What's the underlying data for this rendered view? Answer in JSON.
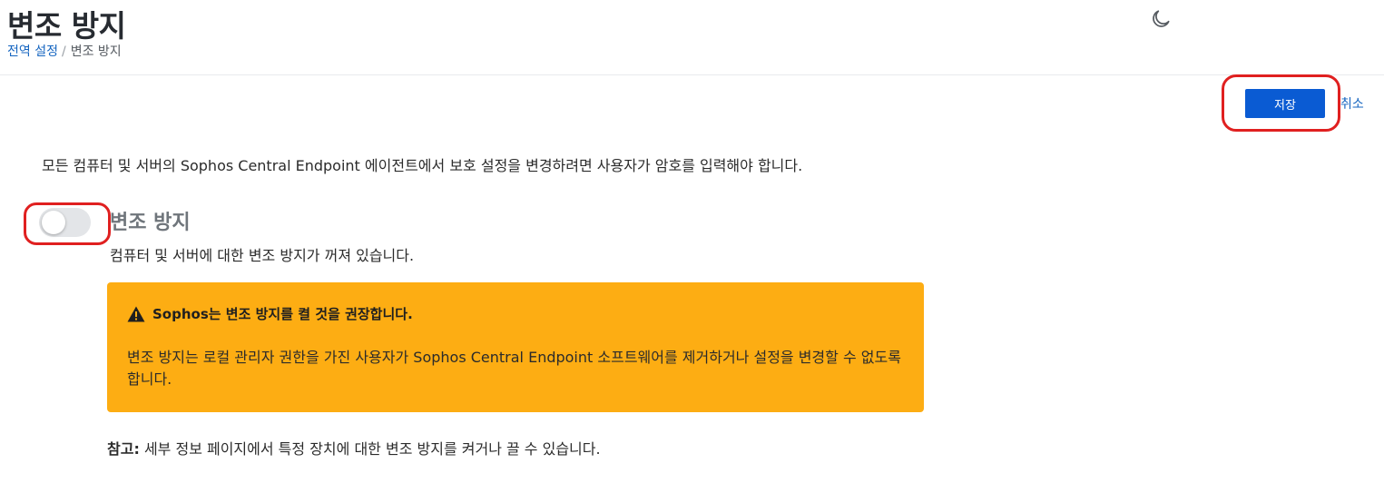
{
  "header": {
    "title": "변조 방지",
    "breadcrumb": {
      "parent": "전역 설정",
      "separator": "/",
      "current": "변조 방지"
    },
    "theme_icon": "moon-icon"
  },
  "actions": {
    "save_label": "저장",
    "cancel_label": "취소"
  },
  "description": "모든 컴퓨터 및 서버의 Sophos Central Endpoint 에이전트에서 보호 설정을 변경하려면 사용자가 암호를 입력해야 합니다.",
  "setting": {
    "title": "변조 방지",
    "enabled": false,
    "status": "컴퓨터 및 서버에 대한 변조 방지가 꺼져 있습니다."
  },
  "warning": {
    "icon": "warning-triangle-icon",
    "title": "Sophos는 변조 방지를 켤 것을 권장합니다.",
    "body": "변조 방지는 로컬 관리자 권한을 가진 사용자가 Sophos Central Endpoint 소프트웨어를 제거하거나 설정을 변경할 수 없도록 합니다."
  },
  "note": {
    "label": "참고",
    "separator": ":",
    "text": " 세부 정보 페이지에서 특정 장치에 대한 변조 방지를 켜거나 끌 수 있습니다."
  },
  "colors": {
    "primary": "#0a5bd3",
    "link": "#1565c0",
    "warning_bg": "#fdad13",
    "annotation": "#e02020",
    "toggle_off": "#e3e5e8"
  }
}
